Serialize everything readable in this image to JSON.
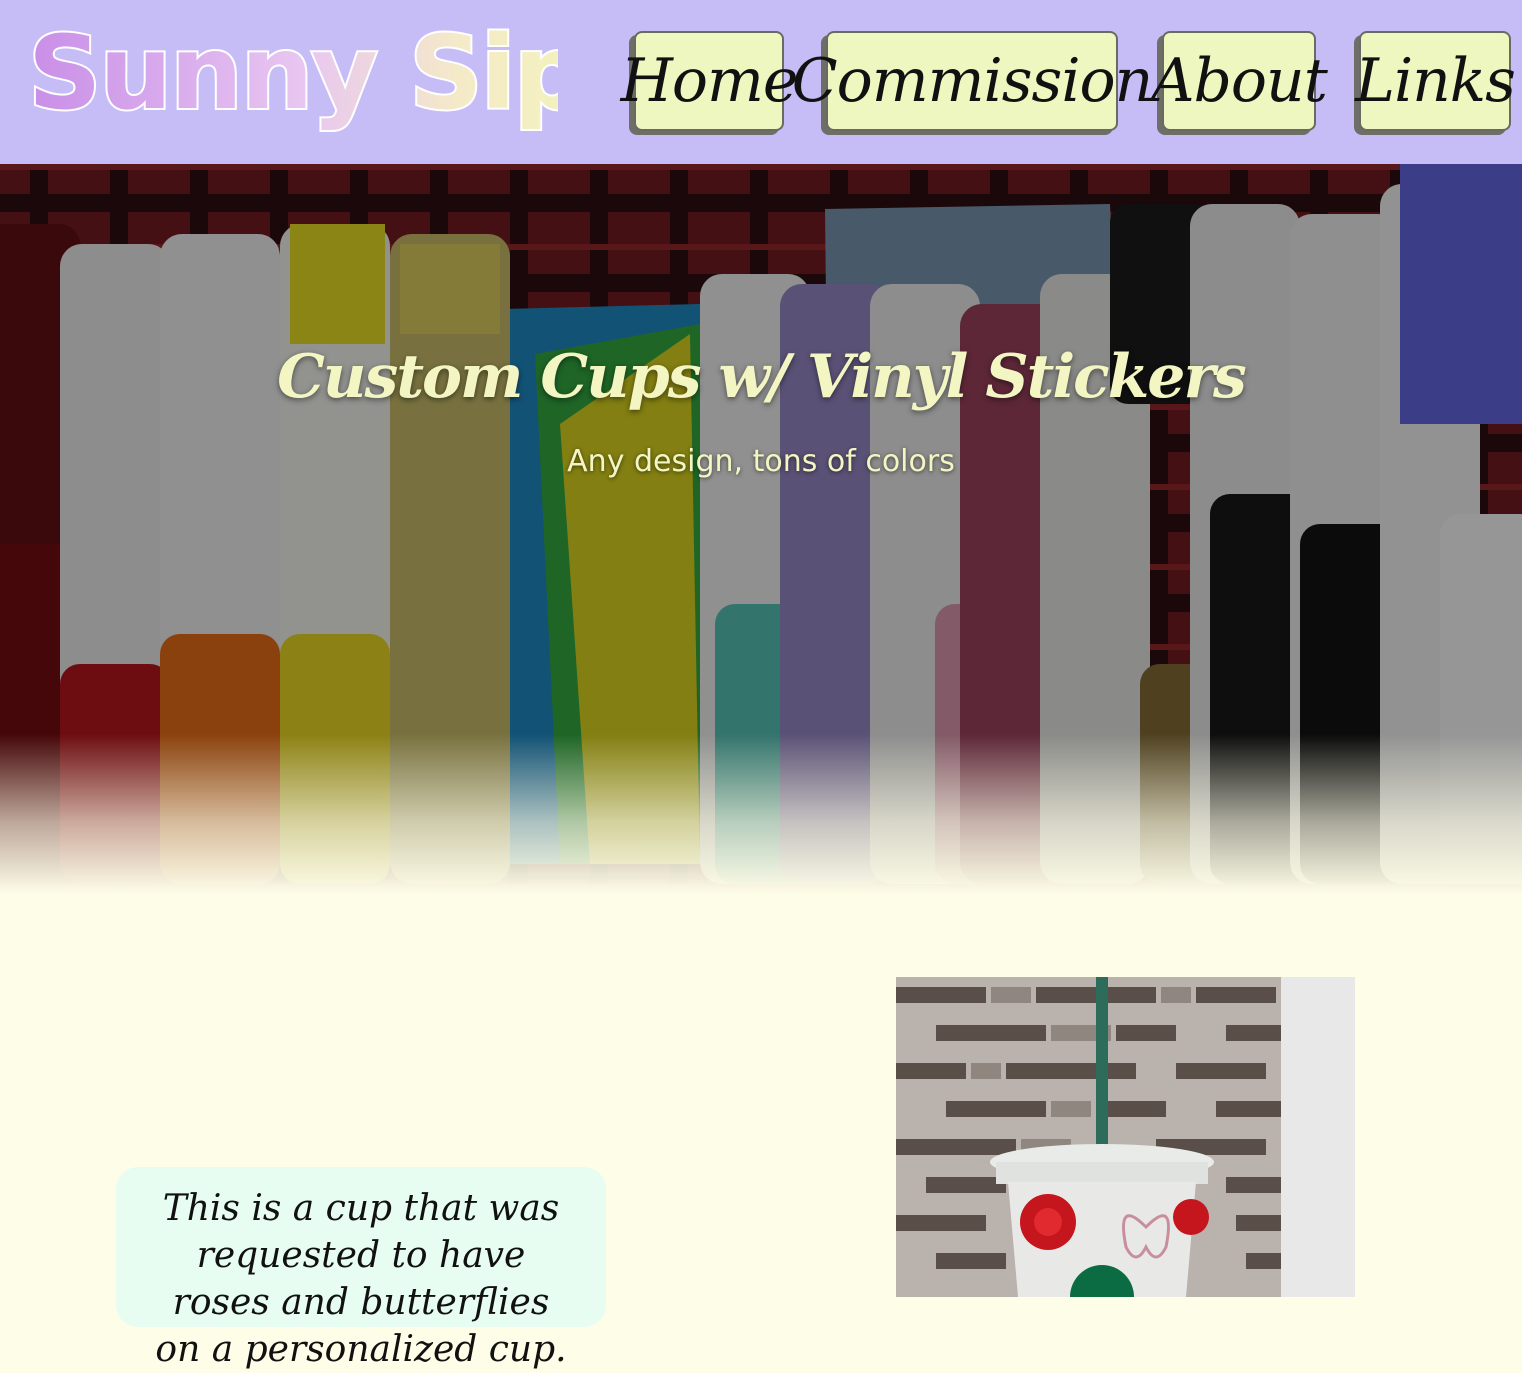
{
  "site": {
    "logo_text": "Sunny Sips"
  },
  "nav": {
    "items": [
      {
        "label": "Home"
      },
      {
        "label": "Commission"
      },
      {
        "label": "About"
      },
      {
        "label": "Links"
      }
    ]
  },
  "hero": {
    "title": "Custom Cups w/ Vinyl Stickers",
    "subtitle": "Any design, tons of colors"
  },
  "content": {
    "caption": "This is a cup that was requested to have roses and butterflies on a personalized cup."
  },
  "colors": {
    "header_bg": "#c6bdf7",
    "nav_button_bg": "#eef7bf",
    "page_bg": "#fefde8",
    "caption_card_bg": "#e7fdf1",
    "hero_text": "#f3f6c3"
  }
}
